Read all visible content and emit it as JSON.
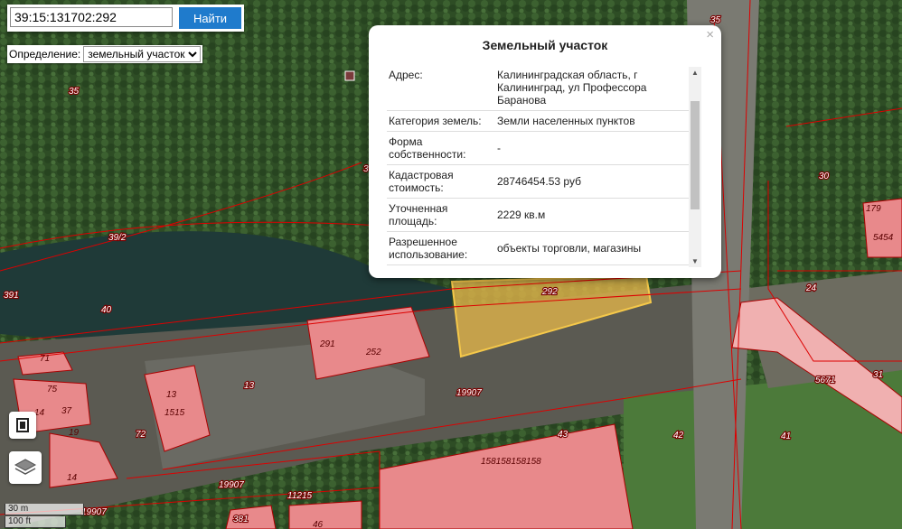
{
  "search": {
    "value": "39:15:131702:292",
    "button": "Найти"
  },
  "definition": {
    "label": "Определение:",
    "selected": "земельный участок"
  },
  "popup": {
    "title": "Земельный участок",
    "close": "×",
    "rows": [
      {
        "key": "Адрес:",
        "value": "Калининградская область, г Калининград, ул Профессора Баранова"
      },
      {
        "key": "Категория земель:",
        "value": "Земли населенных пунктов"
      },
      {
        "key": "Форма собственности:",
        "value": "-"
      },
      {
        "key": "Кадастровая стоимость:",
        "value": "28746454.53 руб"
      },
      {
        "key": "Уточненная площадь:",
        "value": "2229 кв.м"
      },
      {
        "key": "Разрешенное использование:",
        "value": "объекты торговли, магазины"
      }
    ]
  },
  "scale": {
    "metric": "30 m",
    "imperial": "100 ft"
  },
  "parcel_labels": [
    {
      "id": "35a",
      "text": "35"
    },
    {
      "id": "35b",
      "text": "35"
    },
    {
      "id": "39_2",
      "text": "39/2"
    },
    {
      "id": "40",
      "text": "40"
    },
    {
      "id": "292",
      "text": "292"
    },
    {
      "id": "291",
      "text": "291"
    },
    {
      "id": "252",
      "text": "252"
    },
    {
      "id": "13a",
      "text": "13"
    },
    {
      "id": "13b",
      "text": "13"
    },
    {
      "id": "1515",
      "text": "1515"
    },
    {
      "id": "71",
      "text": "71"
    },
    {
      "id": "75",
      "text": "75"
    },
    {
      "id": "14a",
      "text": "14"
    },
    {
      "id": "37",
      "text": "37"
    },
    {
      "id": "19",
      "text": "19"
    },
    {
      "id": "14b",
      "text": "14"
    },
    {
      "id": "72",
      "text": "72"
    },
    {
      "id": "19907a",
      "text": "19907"
    },
    {
      "id": "19907b",
      "text": "19907"
    },
    {
      "id": "19907c",
      "text": "19907"
    },
    {
      "id": "43",
      "text": "43"
    },
    {
      "id": "158",
      "text": "158158158158"
    },
    {
      "id": "42",
      "text": "42"
    },
    {
      "id": "11215",
      "text": "11215"
    },
    {
      "id": "381",
      "text": "381"
    },
    {
      "id": "46",
      "text": "46"
    },
    {
      "id": "30",
      "text": "30"
    },
    {
      "id": "179",
      "text": "179"
    },
    {
      "id": "5454",
      "text": "5454"
    },
    {
      "id": "24",
      "text": "24"
    },
    {
      "id": "31",
      "text": "31"
    },
    {
      "id": "5671",
      "text": "5671"
    },
    {
      "id": "41",
      "text": "41"
    },
    {
      "id": "391",
      "text": "391"
    },
    {
      "id": "3",
      "text": "3"
    }
  ]
}
